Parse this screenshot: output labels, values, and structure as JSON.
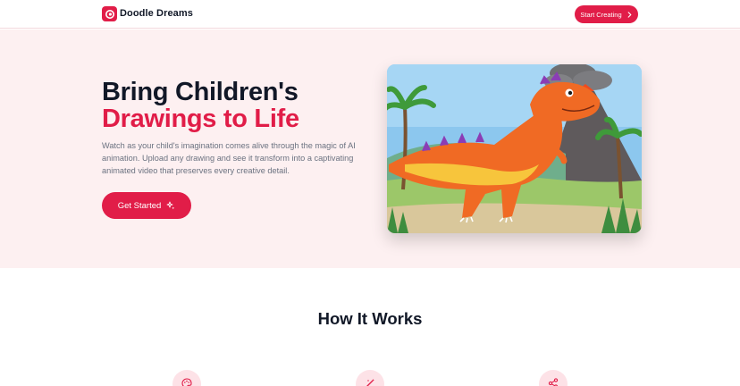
{
  "header": {
    "brand": "Doodle Dreams",
    "cta_label": "Start Creating",
    "icons": {
      "logo": "doodle-logo-icon",
      "cta": "chevron-right-icon"
    }
  },
  "hero": {
    "title_line1": "Bring Children's",
    "title_line2": "Drawings to Life",
    "description": "Watch as your child's imagination comes alive through the magic of AI animation. Upload any drawing and see it transform into a captivating animated video that preserves every creative detail.",
    "button_label": "Get Started",
    "button_icon": "sparkles-icon",
    "image": "orange-dinosaur-illustration"
  },
  "how_it_works": {
    "heading": "How It Works",
    "step_icons": [
      "palette-icon",
      "magic-wand-icon",
      "share-icon"
    ]
  },
  "colors": {
    "accent": "#e11d48",
    "hero_bg": "#fdf0f1",
    "icon_bg": "#fde2e7",
    "heading": "#111827",
    "body_text": "#6b7280"
  }
}
